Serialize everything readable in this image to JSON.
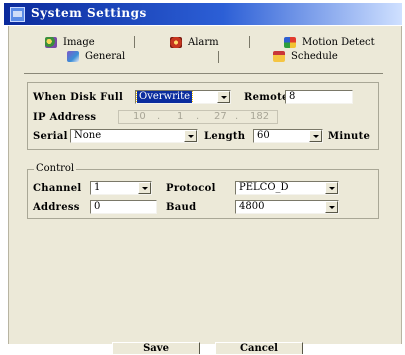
{
  "window": {
    "title": "System Settings"
  },
  "tabs": {
    "image": "Image",
    "alarm": "Alarm",
    "motion_detect": "Motion Detect",
    "general": "General",
    "schedule": "Schedule"
  },
  "general": {
    "when_disk_full_label": "When Disk Full",
    "when_disk_full_value": "Overwrite",
    "remote_label": "Remote",
    "remote_value": "8",
    "ip_label": "IP Address",
    "ip_octets": [
      "10",
      "1",
      "27",
      "182"
    ],
    "serial_label": "Serial",
    "serial_value": "None",
    "length_label": "Length",
    "length_value": "60",
    "length_unit": "Minute"
  },
  "control": {
    "legend": "Control",
    "channel_label": "Channel",
    "channel_value": "1",
    "protocol_label": "Protocol",
    "protocol_value": "PELCO_D",
    "address_label": "Address",
    "address_value": "0",
    "baud_label": "Baud",
    "baud_value": "4800"
  },
  "buttons": {
    "save": "Save",
    "cancel": "Cancel"
  }
}
